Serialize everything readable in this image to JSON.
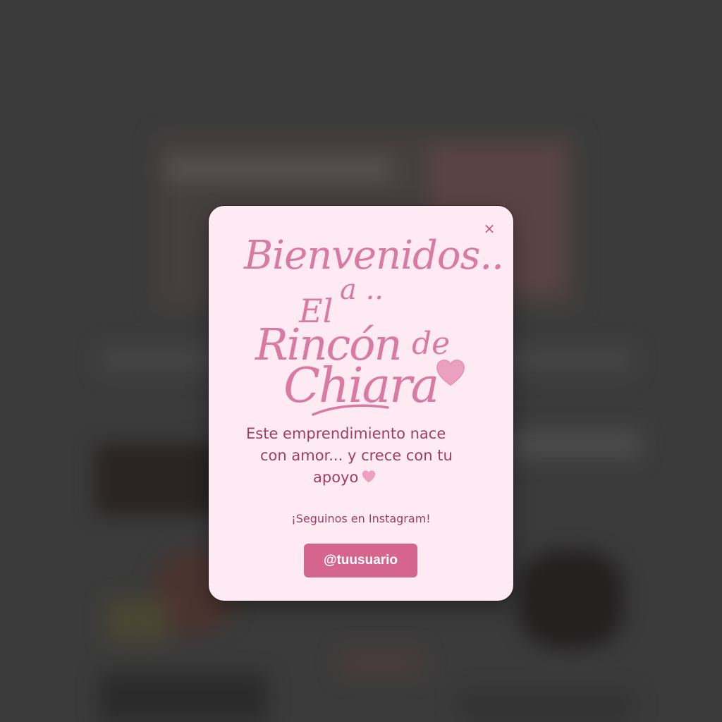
{
  "modal": {
    "close_label": "×",
    "title_line1": "Bienvenidos..",
    "title_line2": "a ..",
    "title_line3": "El",
    "title_line4": "Rincón",
    "title_line5": "de",
    "title_line6": "Chiara",
    "description_line1": "Este emprendimiento nace",
    "description_line2": "con amor... y crece con tu",
    "description_line3": "apoyo",
    "follow_text": "¡Seguinos en Instagram!",
    "instagram_button_label": "@tuusuario"
  },
  "icons": {
    "close": "close-icon",
    "title_heart": "heart-icon",
    "description_heart": "heart-icon"
  },
  "colors": {
    "modal_background": "#fdeaf2",
    "script_pink": "#d97aa3",
    "text_rose": "#a13d63",
    "button_pink": "#d5658d",
    "overlay": "#3b3b3b"
  }
}
